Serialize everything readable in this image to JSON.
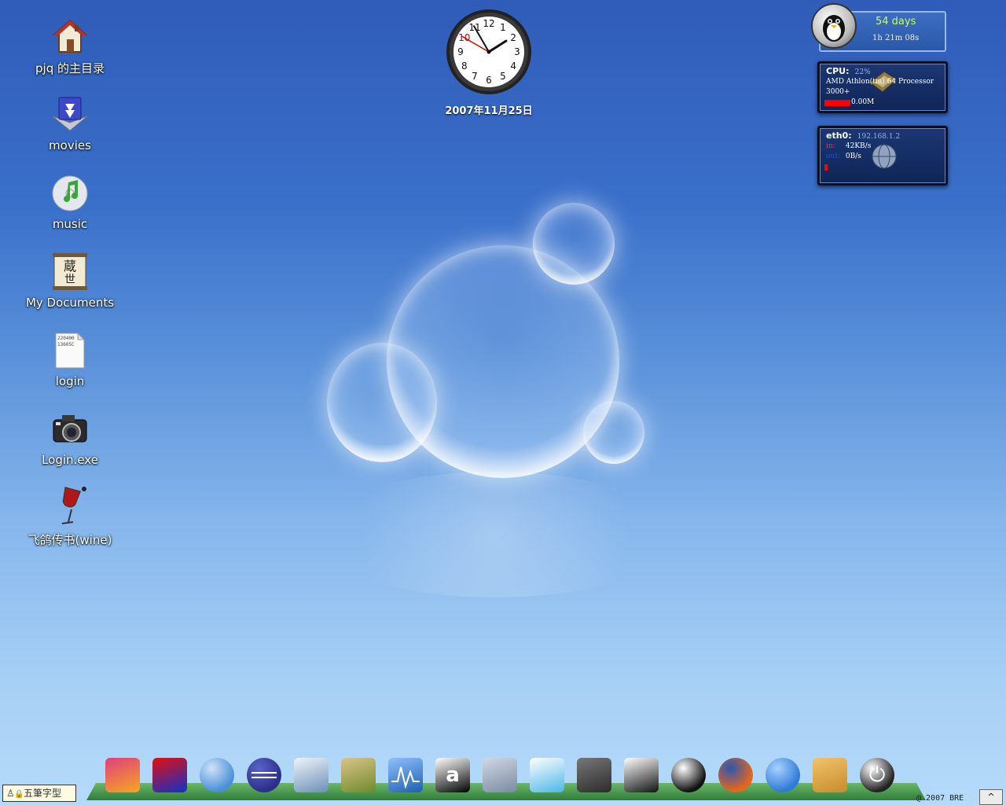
{
  "desktop": {
    "icons": [
      {
        "label": "pjq 的主目录",
        "icon": "home-folder-icon"
      },
      {
        "label": "movies",
        "icon": "movies-folder-icon"
      },
      {
        "label": "music",
        "icon": "music-folder-icon"
      },
      {
        "label": "My Documents",
        "icon": "documents-scroll-icon"
      },
      {
        "label": "login",
        "icon": "text-file-icon",
        "file_preview": "220400\n13605C"
      },
      {
        "label": "Login.exe",
        "icon": "camera-icon"
      },
      {
        "label": "飞鸽传书(wine)",
        "icon": "wine-glass-icon"
      }
    ]
  },
  "clock": {
    "date": "2007年11月25日",
    "hour": 1,
    "minute": 55,
    "second": 50
  },
  "uptime_widget": {
    "days": "54 days",
    "time": "1h 21m 08s"
  },
  "cpu_widget": {
    "label": "CPU:",
    "usage": "22%",
    "model_line1": "AMD Athlon(tm) 64 Processor",
    "model_line2": "3000+",
    "freq": "0.00M",
    "usage_fraction": 0.22
  },
  "net_widget": {
    "iface": "eth0:",
    "ip": "192.168.1.2",
    "in_label": "in:",
    "in_rate": "42KB/s",
    "out_label": "out:",
    "out_rate": "0B/s"
  },
  "dock": {
    "items": [
      {
        "icon": "pinwheel-app-icon"
      },
      {
        "icon": "runner-red-app-icon"
      },
      {
        "icon": "video-chat-icon"
      },
      {
        "icon": "eclipse-icon"
      },
      {
        "icon": "puzzle-extensions-icon"
      },
      {
        "icon": "book-icon"
      },
      {
        "icon": "system-monitor-icon"
      },
      {
        "icon": "amarok-icon"
      },
      {
        "icon": "media-player-icon"
      },
      {
        "icon": "workspace-switch-icon"
      },
      {
        "icon": "camera-icon"
      },
      {
        "icon": "tux-board-icon"
      },
      {
        "icon": "qq-penguin-icon"
      },
      {
        "icon": "firefox-icon"
      },
      {
        "icon": "realplayer-icon"
      },
      {
        "icon": "file-cabinet-icon"
      },
      {
        "icon": "power-icon"
      }
    ]
  },
  "ime": {
    "label": "五筆字型"
  },
  "tray": {
    "copyright": "@ 2007 BRE",
    "button": "^"
  }
}
